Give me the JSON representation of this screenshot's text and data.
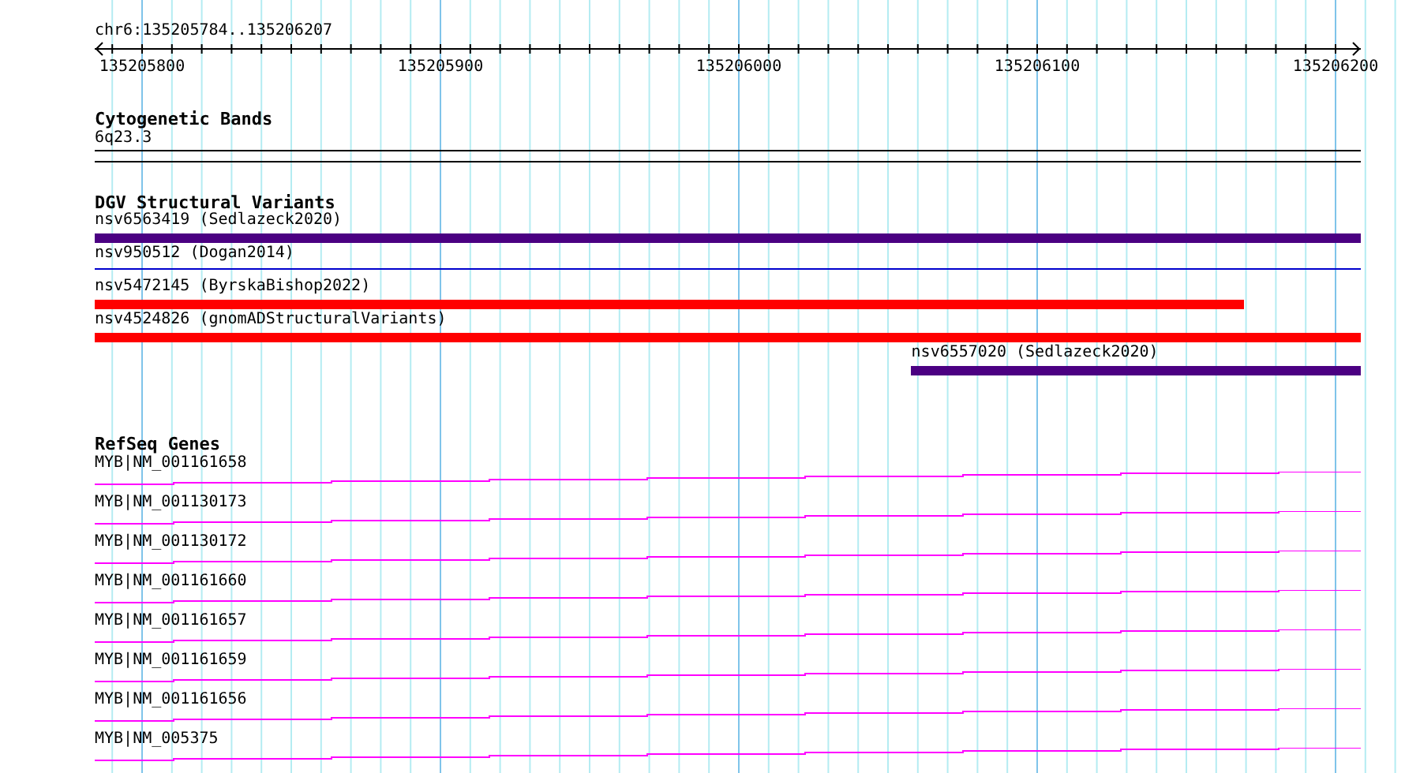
{
  "location": "chr6:135205784..135206207",
  "ruler": {
    "labels": [
      "135205800",
      "135205900",
      "135206000",
      "135206100",
      "135206200"
    ]
  },
  "tracks": [
    {
      "kind": "bands",
      "title": "Cytogenetic Bands",
      "features": [
        {
          "label": "6q23.3"
        }
      ]
    },
    {
      "kind": "variants",
      "title": "DGV Structural Variants",
      "features": [
        {
          "label": "nsv6563419 (Sedlazeck2020)",
          "color": "#4b0082",
          "kind": "thick"
        },
        {
          "label": "nsv950512 (Dogan2014)",
          "color": "#0000cd",
          "kind": "thin"
        },
        {
          "label": "nsv5472145 (ByrskaBishop2022)",
          "color": "#ff0000",
          "kind": "thick"
        },
        {
          "label": "nsv4524826 (gnomADStructuralVariants)",
          "color": "#ff0000",
          "kind": "thick"
        },
        {
          "label": "nsv6557020 (Sedlazeck2020)",
          "color": "#4b0082",
          "kind": "thick"
        }
      ]
    },
    {
      "kind": "genes",
      "title": "RefSeq Genes",
      "features": [
        {
          "label": "MYB|NM_001161658"
        },
        {
          "label": "MYB|NM_001130173"
        },
        {
          "label": "MYB|NM_001130172"
        },
        {
          "label": "MYB|NM_001161660"
        },
        {
          "label": "MYB|NM_001161657"
        },
        {
          "label": "MYB|NM_001161659"
        },
        {
          "label": "MYB|NM_001161656"
        },
        {
          "label": "MYB|NM_005375"
        }
      ]
    }
  ]
}
